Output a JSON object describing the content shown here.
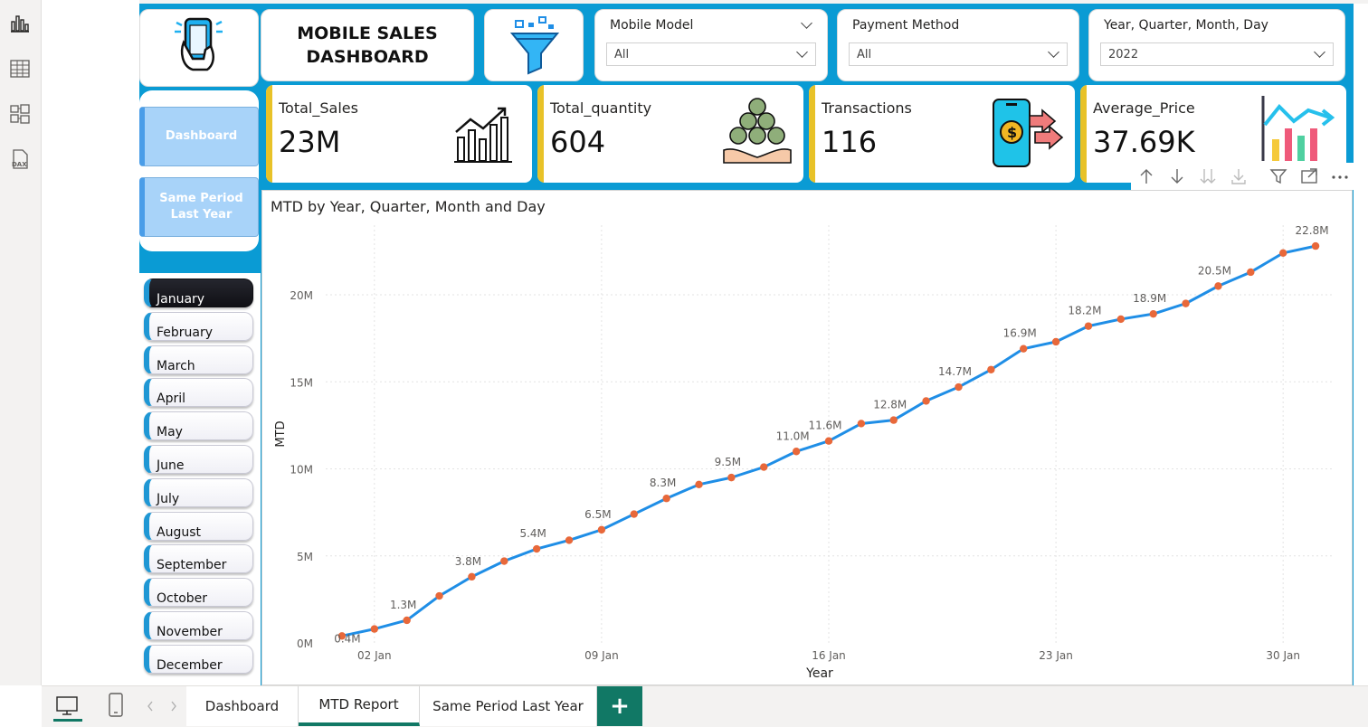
{
  "dashboard": {
    "title_line1": "MOBILE SALES",
    "title_line2": "DASHBOARD"
  },
  "slicers": [
    {
      "label": "Mobile Model",
      "value": "All"
    },
    {
      "label": "Payment Method",
      "value": "All"
    },
    {
      "label": "Year, Quarter, Month, Day",
      "value": "2022"
    }
  ],
  "kpis": [
    {
      "label": "Total_Sales",
      "value": "23M",
      "icon": "sales-growth-chart-icon"
    },
    {
      "label": "Total_quantity",
      "value": "604",
      "icon": "coins-stack-hands-icon"
    },
    {
      "label": "Transactions",
      "value": "116",
      "icon": "phone-payment-icon"
    },
    {
      "label": "Average_Price",
      "value": "37.69K",
      "icon": "bar-chart-trend-icon"
    }
  ],
  "nav_buttons": [
    {
      "label": "Dashboard"
    },
    {
      "label": "Same Period Last Year"
    }
  ],
  "months": [
    "January",
    "February",
    "March",
    "April",
    "May",
    "June",
    "July",
    "August",
    "September",
    "October",
    "November",
    "December"
  ],
  "active_month": "January",
  "colors": {
    "canvas": "#0a9bd4",
    "kpi_accent": "#e8c228",
    "line": "#1f8ee6",
    "marker": "#e8683a",
    "tab_accent": "#117865"
  },
  "chart_data": {
    "type": "line",
    "title": "MTD by Year, Quarter, Month and Day",
    "xlabel": "Year",
    "ylabel": "MTD",
    "x_ticks": [
      "02 Jan",
      "09 Jan",
      "16 Jan",
      "23 Jan",
      "30 Jan"
    ],
    "y_ticks": [
      "0M",
      "5M",
      "10M",
      "15M",
      "20M"
    ],
    "ylim": [
      0,
      24
    ],
    "x": [
      1,
      2,
      3,
      4,
      5,
      6,
      7,
      8,
      9,
      10,
      11,
      12,
      13,
      14,
      15,
      16,
      17,
      18,
      19,
      20,
      21,
      22,
      23,
      24,
      25,
      26,
      27,
      28,
      29,
      30,
      31
    ],
    "values": [
      0.4,
      0.8,
      1.3,
      2.7,
      3.8,
      4.7,
      5.4,
      5.9,
      6.5,
      7.4,
      8.3,
      9.1,
      9.5,
      10.1,
      11.0,
      11.6,
      12.6,
      12.8,
      13.9,
      14.7,
      15.7,
      16.9,
      17.3,
      18.2,
      18.6,
      18.9,
      19.5,
      20.5,
      21.3,
      22.4,
      22.8
    ],
    "data_labels": {
      "1": "0.4M",
      "3": "1.3M",
      "5": "3.8M",
      "7": "5.4M",
      "9": "6.5M",
      "11": "8.3M",
      "13": "9.5M",
      "15": "11.0M",
      "16": "11.6M",
      "18": "12.8M",
      "20": "14.7M",
      "22": "16.9M",
      "24": "18.2M",
      "26": "18.9M",
      "28": "20.5M",
      "31": "22.8M"
    },
    "grid": true,
    "legend": "none"
  },
  "tabs": [
    {
      "label": "Dashboard",
      "active": false
    },
    {
      "label": "MTD Report",
      "active": true
    },
    {
      "label": "Same Period Last Year",
      "active": false
    }
  ],
  "tab_add_label": "+"
}
